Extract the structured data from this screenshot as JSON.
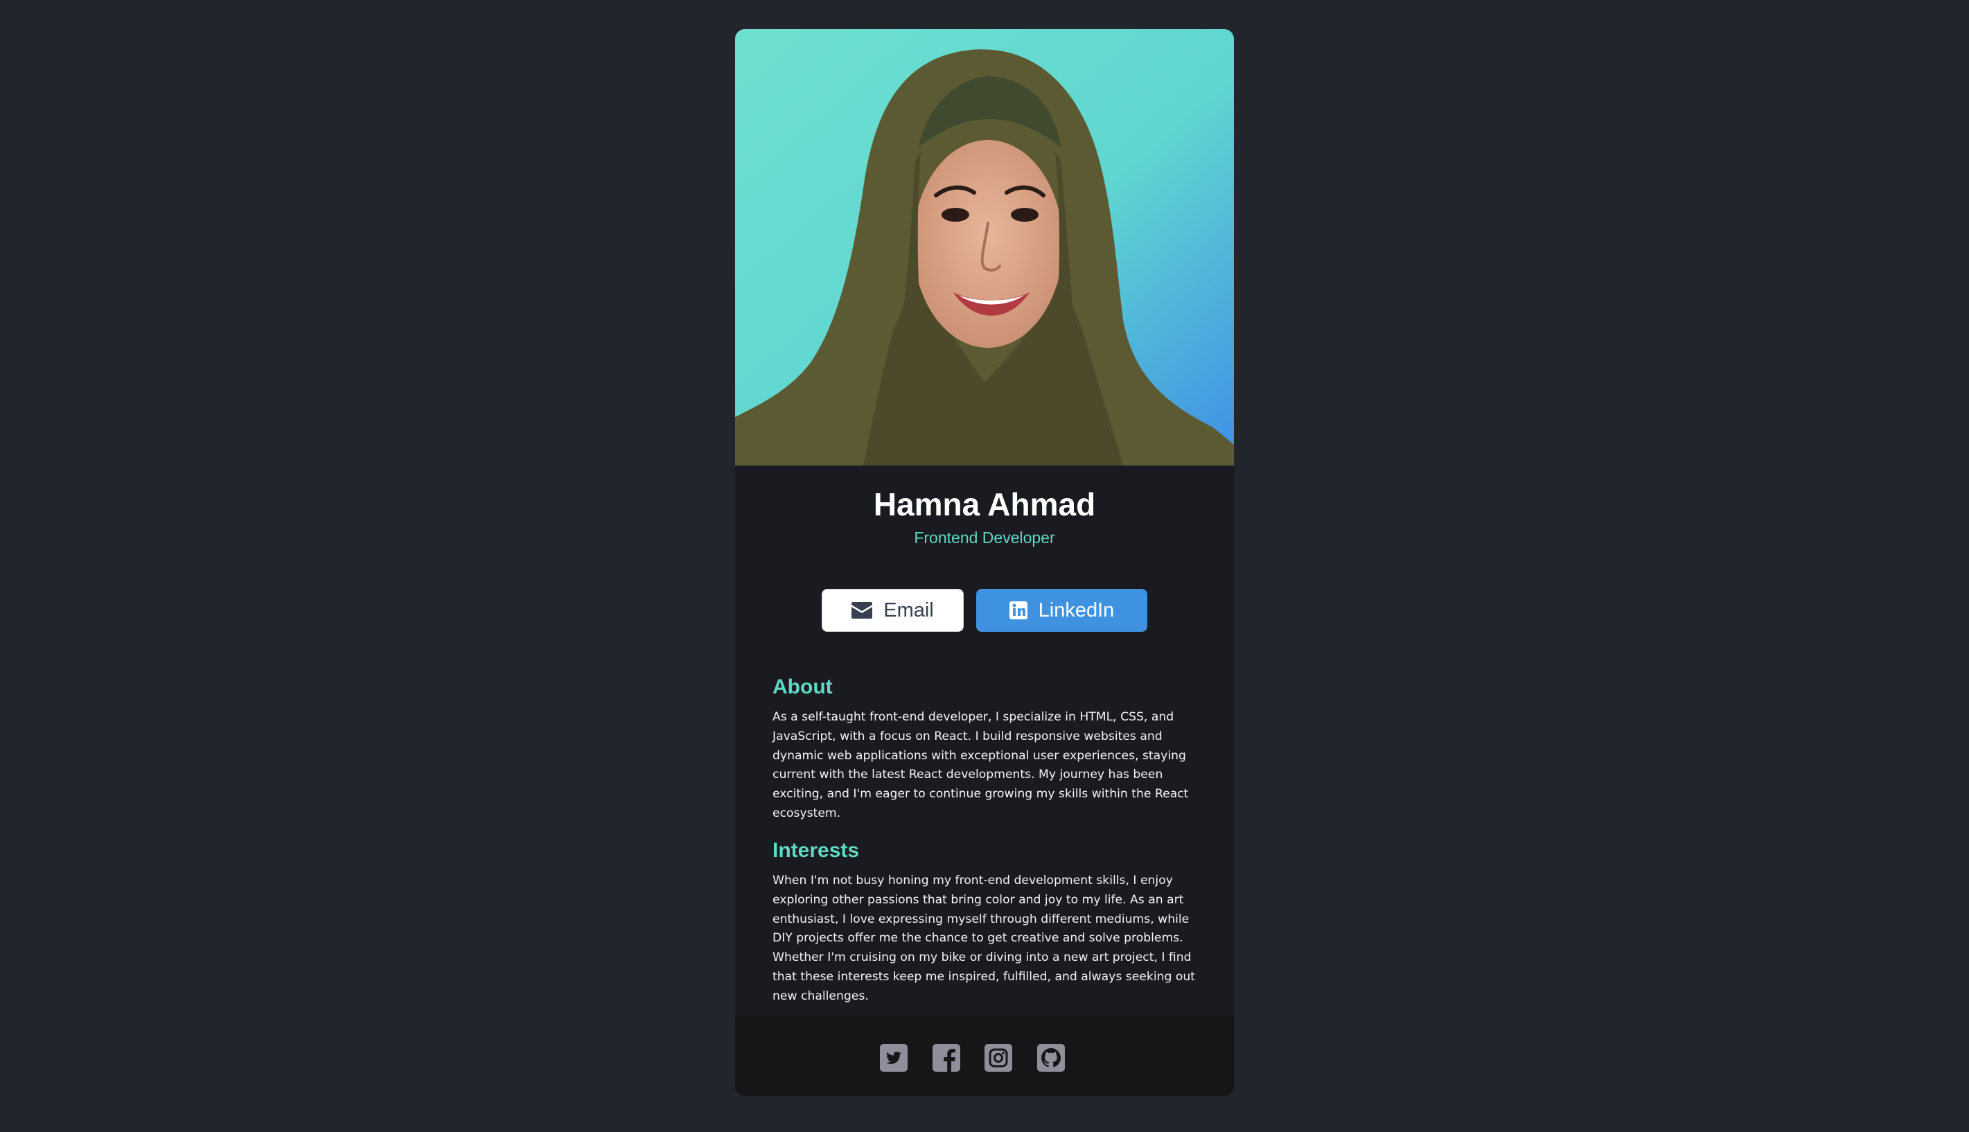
{
  "profile": {
    "name": "Hamna Ahmad",
    "title": "Frontend Developer",
    "photo_alt": "Hamna Ahmad"
  },
  "buttons": {
    "email_label": "Email",
    "linkedin_label": "LinkedIn"
  },
  "about": {
    "heading": "About",
    "text": "As a self-taught front-end developer, I specialize in HTML, CSS, and JavaScript, with a focus on React. I build responsive websites and dynamic web applications with exceptional user experiences, staying current with the latest React developments. My journey has been exciting, and I'm eager to continue growing my skills within the React ecosystem."
  },
  "interests": {
    "heading": "Interests",
    "text": "When I'm not busy honing my front-end development skills, I enjoy exploring other passions that bring color and joy to my life. As an art enthusiast, I love expressing myself through different mediums, while DIY projects offer me the chance to get creative and solve problems. Whether I'm cruising on my bike or diving into a new art project, I find that these interests keep me inspired, fulfilled, and always seeking out new challenges."
  },
  "footer": {
    "icons": [
      "twitter-icon",
      "facebook-icon",
      "instagram-icon",
      "github-icon"
    ]
  },
  "colors": {
    "page_background": "#23252c",
    "card_background": "#1a1b20",
    "footer_background": "#161619",
    "accent": "#5fd9c4",
    "linkedin_blue": "#3f92e0",
    "social_icon": "#918e9b"
  }
}
